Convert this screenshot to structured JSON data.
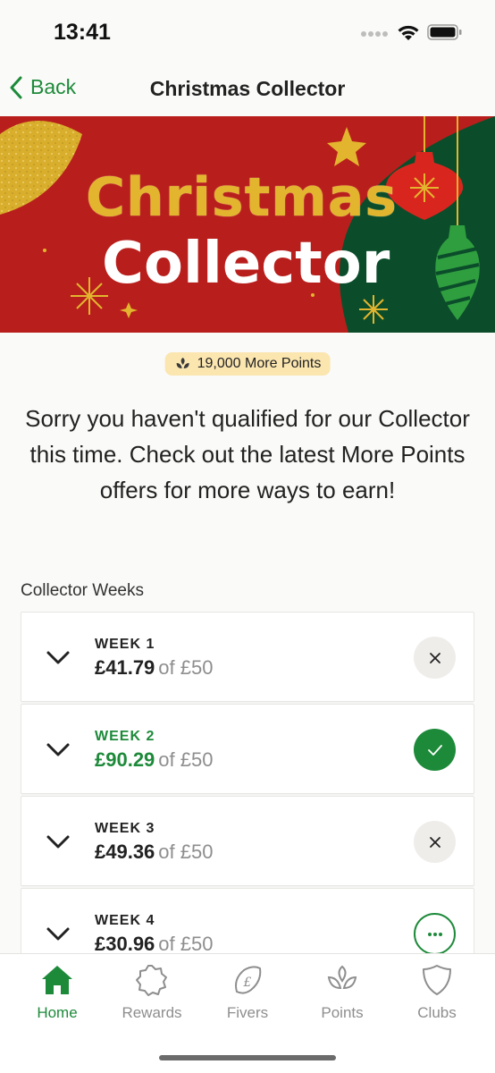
{
  "status_bar": {
    "time": "13:41"
  },
  "nav": {
    "back_label": "Back",
    "title": "Christmas Collector"
  },
  "banner": {
    "line1": "Christmas",
    "line2": "Collector"
  },
  "badge": {
    "text": "19,000 More Points"
  },
  "message": "Sorry you haven't qualified for our Collector this time. Check out the latest More Points offers for more ways to earn!",
  "section_title": "Collector Weeks",
  "weeks": [
    {
      "label": "WEEK 1",
      "spent": "£41.79",
      "target": "of £50",
      "status": "not-qualified"
    },
    {
      "label": "WEEK 2",
      "spent": "£90.29",
      "target": "of £50",
      "status": "qualified"
    },
    {
      "label": "WEEK 3",
      "spent": "£49.36",
      "target": "of £50",
      "status": "not-qualified"
    },
    {
      "label": "WEEK 4",
      "spent": "£30.96",
      "target": "of £50",
      "status": "in-progress"
    }
  ],
  "tabs": [
    {
      "label": "Home",
      "icon": "home-icon",
      "active": true
    },
    {
      "label": "Rewards",
      "icon": "rewards-badge-icon",
      "active": false
    },
    {
      "label": "Fivers",
      "icon": "fivers-pound-icon",
      "active": false
    },
    {
      "label": "Points",
      "icon": "points-leaf-icon",
      "active": false
    },
    {
      "label": "Clubs",
      "icon": "clubs-shield-icon",
      "active": false
    }
  ],
  "colors": {
    "brand_green": "#1d8a3a",
    "banner_red": "#b81f1c",
    "banner_dark_green": "#0b4d2a",
    "gold": "#e3b52e",
    "badge_bg": "#fbe6b0"
  }
}
